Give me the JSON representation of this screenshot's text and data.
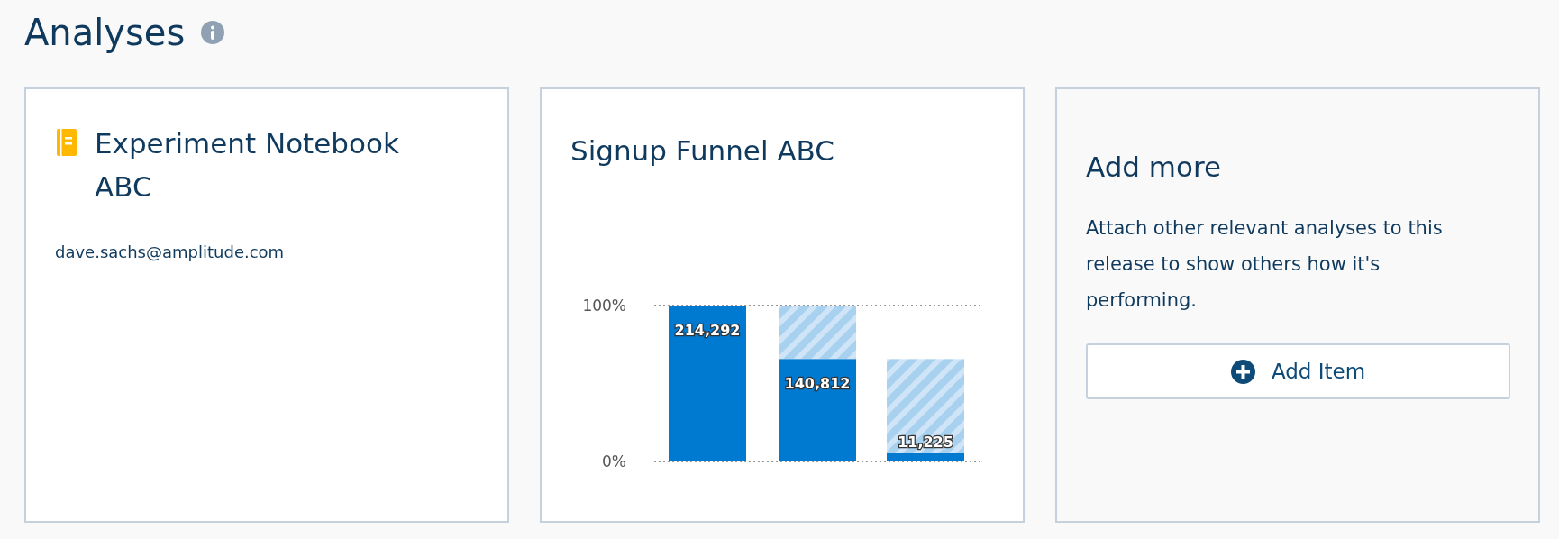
{
  "title": "Analyses",
  "cards": [
    {
      "kind": "notebook",
      "title": "Experiment Notebook ABC",
      "owner": "dave.sachs@amplitude.com"
    },
    {
      "kind": "chart",
      "title": "Signup Funnel ABC",
      "chart_data": {
        "type": "bar",
        "stacked": true,
        "categories": [
          "214,292",
          "140,812",
          "11,225"
        ],
        "ylim": [
          0,
          100
        ],
        "yticks": [
          {
            "value": 0,
            "label": "0%"
          },
          {
            "value": 100,
            "label": "100%"
          }
        ],
        "value_labels": [
          "214,292",
          "140,812",
          "11,225"
        ],
        "series": [
          {
            "color": "#0079d1",
            "values": [
              100,
              65.7,
              5.2
            ]
          },
          {
            "color": "#a8d1f0",
            "values": [
              0,
              34.3,
              60.5
            ]
          }
        ]
      }
    },
    {
      "kind": "add",
      "title": "Add more",
      "description": "Attach other relevant analyses to this release to show others how it's performing.",
      "button": "Add Item"
    }
  ]
}
